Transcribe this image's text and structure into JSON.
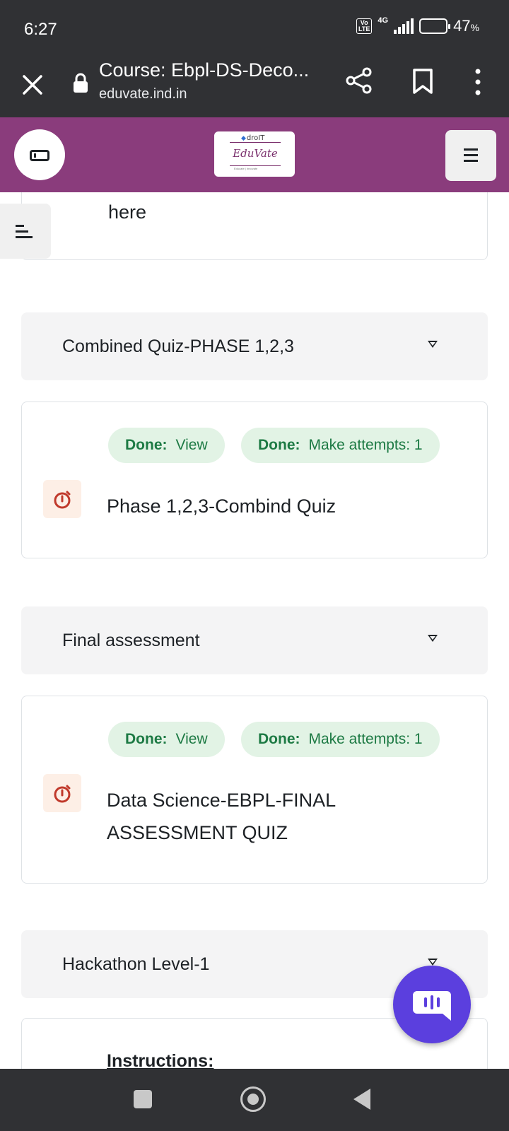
{
  "status": {
    "time": "6:27",
    "volte": "Vo\nLTE",
    "network": "4G",
    "battery": "47",
    "battery_unit": "%",
    "battery_level": 0.47
  },
  "browser": {
    "title": "Course: Ebpl-DS-Deco...",
    "host": "eduvate.ind.in"
  },
  "site": {
    "logo_top": "droIT",
    "logo_main": "EduVate",
    "logo_tag": "Educate | Innovate"
  },
  "content": {
    "partial_text": "here",
    "sections": [
      {
        "title": "Combined Quiz-PHASE 1,2,3",
        "activity": {
          "completion": [
            {
              "label": "Done:",
              "value": "View"
            },
            {
              "label": "Done:",
              "value": "Make attempts: 1"
            }
          ],
          "name": "Phase 1,2,3-Combind Quiz"
        }
      },
      {
        "title": "Final assessment",
        "activity": {
          "completion": [
            {
              "label": "Done:",
              "value": "View"
            },
            {
              "label": "Done:",
              "value": "Make attempts: 1"
            }
          ],
          "name": "Data Science-EBPL-FINAL ASSESSMENT QUIZ"
        }
      },
      {
        "title": "Hackathon Level-1",
        "first_text": "Instructions:"
      }
    ]
  },
  "colors": {
    "header": "#8a3c7c",
    "done_pill": "#e2f3e5",
    "done_text": "#1d7a44",
    "quiz_icon": "#c0392b",
    "chat_fab": "#5b3fde"
  }
}
